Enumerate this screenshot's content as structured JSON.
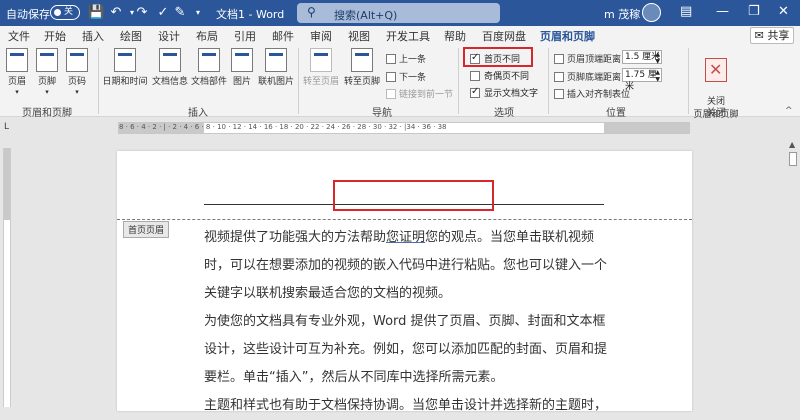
{
  "titlebar": {
    "autosave_label": "自动保存",
    "toggle_label": "关",
    "doc_title": "文档1 - Word",
    "search_text": "搜索(Alt+Q)",
    "user_name": "m 茂稼",
    "minimize": "—",
    "restore": "❐",
    "close": "✕",
    "pen_icon": "✎",
    "undo": "↶",
    "redo": "↷",
    "checkmark": "✓",
    "more": "▾"
  },
  "tabs": [
    "文件",
    "开始",
    "插入",
    "绘图",
    "设计",
    "布局",
    "引用",
    "邮件",
    "审阅",
    "视图",
    "开发工具",
    "帮助",
    "百度网盘",
    "页眉和页脚"
  ],
  "share_label": "共享",
  "ribbon": {
    "header": "页眉",
    "footer": "页脚",
    "page_number": "页码",
    "group_hf": "页眉和页脚",
    "datetime": "日期和时间",
    "docinfo": "文档信息",
    "docparts": "文档部件",
    "picture": "图片",
    "online_picture": "联机图片",
    "group_insert": "插入",
    "goto_header": "转至页眉",
    "goto_footer": "转至页脚",
    "prev": "上一条",
    "next": "下一条",
    "link_prev": "链接到前一节",
    "group_nav": "导航",
    "first_page_diff": "首页不同",
    "odd_even_diff": "奇偶页不同",
    "show_doc_text": "显示文档文字",
    "group_options": "选项",
    "header_top_label": "页眉顶端距离:",
    "header_top_value": "1.5 厘米",
    "footer_bottom_label": "页脚底端距离:",
    "footer_bottom_value": "1.75 厘米",
    "insert_align_tab": "插入对齐制表位",
    "group_position": "位置",
    "close_hf": "关闭\n页眉和页脚",
    "group_close": "关闭",
    "collapse": "^"
  },
  "ruler_ticks": "8 · 6 · 4 · 2 · | · 2 · 4 · 6 · 8 · 10 · 12 · 14 · 16 · 18 · 20 · 22 · 24 · 26 · 28 · 30 · 32 · |34 · 36 · 38",
  "ruler_tab_selector": "L",
  "document": {
    "header_tag": "首页页眉",
    "paragraphs": [
      [
        "视频提供了功能强大的方法帮助",
        "您证明",
        "您的观点。当您单击联机视频时，可以在想要添加的视频的嵌入代码中进行粘贴。您也可以键入一个关键字以联机搜索最适合您的文档的视频。"
      ],
      [
        "为使您的文档具有专业外观，Word 提供了页眉、页脚、封面和文本框设计，这些设计可互为补充。例如，您可以添加匹配的封面、页眉和提要栏。单击“插入”，然后从不同库中选择所需元素。"
      ],
      [
        "主题和样式也有助于文档保持协调。当您单击设计并选择新的主题时，"
      ]
    ]
  }
}
